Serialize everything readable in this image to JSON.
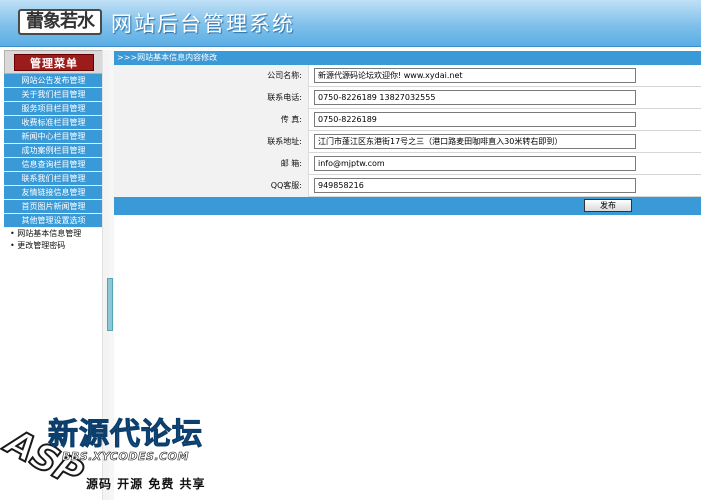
{
  "header": {
    "logo_text": "蕾象若水",
    "title": "网站后台管理系统"
  },
  "sidebar": {
    "menu_title": "管理菜单",
    "items": [
      {
        "label": "网站公告发布管理"
      },
      {
        "label": "关于我们栏目管理"
      },
      {
        "label": "服务项目栏目管理"
      },
      {
        "label": "收费标准栏目管理"
      },
      {
        "label": "新闻中心栏目管理"
      },
      {
        "label": "成功案例栏目管理"
      },
      {
        "label": "信息查询栏目管理"
      },
      {
        "label": "联系我们栏目管理"
      },
      {
        "label": "友情链接信息管理"
      },
      {
        "label": "首页图片新闻管理"
      },
      {
        "label": "其他管理设置选项"
      }
    ],
    "sub_items": [
      {
        "label": "• 网站基本信息管理"
      },
      {
        "label": "• 更改管理密码"
      }
    ]
  },
  "main": {
    "panel_title": ">>>网站基本信息内容修改",
    "fields": [
      {
        "label": "公司名称:",
        "value": "新源代源码论坛欢迎你! www.xydai.net"
      },
      {
        "label": "联系电话:",
        "value": "0750-8226189    13827032555"
      },
      {
        "label": "传    真:",
        "value": "0750-8226189"
      },
      {
        "label": "联系地址:",
        "value": "江门市蓬江区东港街17号之三（港口路麦田咖啡直入30米转右即到）"
      },
      {
        "label": "邮    箱:",
        "value": "info@mjptw.com"
      },
      {
        "label": "QQ客服:",
        "value": "949858216"
      }
    ],
    "publish_label": "发布"
  },
  "watermark": {
    "asp": "ASP",
    "title": "新源代论坛",
    "url": "BBS.XYCODES.COM",
    "slogan": "源码 开源 免费 共享"
  }
}
